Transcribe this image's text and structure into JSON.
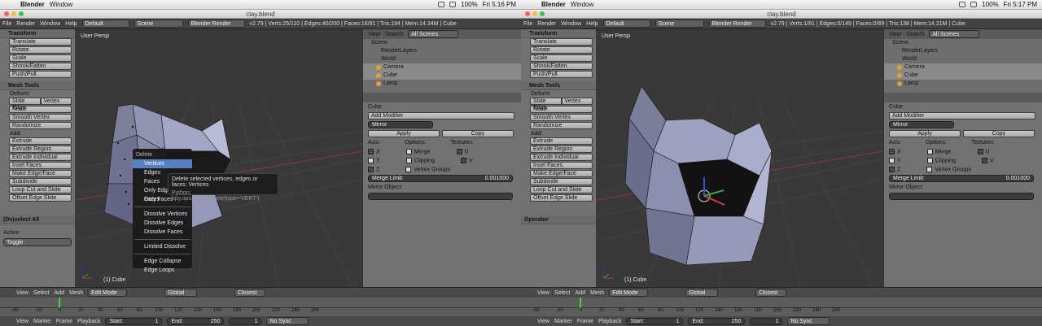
{
  "left": {
    "mac": {
      "apple": "",
      "app": "Blender",
      "menu": "Window",
      "time": "Fri 5:16 PM",
      "battery": "100%"
    },
    "title": "clay.blend",
    "info": {
      "menus": [
        "File",
        "Render",
        "Window",
        "Help"
      ],
      "layout": "Default",
      "scene": "Scene",
      "engine": "Blender Render",
      "stats": "v2.79 | Verts:25/110 | Edges:40/200 | Faces:16/91 | Tris:194 | Mem:14.34M | Cube"
    },
    "tools": {
      "transform_header": "Transform",
      "transform": [
        "Translate",
        "Rotate",
        "Scale",
        "Shrink/Fatten",
        "Push/Pull"
      ],
      "mesh_header": "Mesh Tools",
      "deform": "Deform:",
      "slide_edge": "Slide Edge",
      "vertex": "Vertex",
      "mesh": [
        "Noise",
        "Smooth Vertex",
        "Randomize"
      ],
      "add": "Add:",
      "add_items": [
        "Extrude",
        "Extrude Region",
        "Extrude Individual",
        "Inset Faces",
        "Make Edge/Face",
        "Subdivide",
        "Loop Cut and Slide",
        "Offset Edge Slide"
      ]
    },
    "op": {
      "header": "(De)select All",
      "action_label": "Action",
      "action_value": "Toggle"
    },
    "view": {
      "label": "User Persp",
      "obj": "(1) Cube"
    },
    "menu": {
      "title": "Delete",
      "items": [
        "Vertices",
        "Edges",
        "Faces",
        "Only Edges & Faces",
        "Only Faces"
      ],
      "items2": [
        "Dissolve Vertices",
        "Dissolve Edges",
        "Dissolve Faces"
      ],
      "items3": [
        "Limited Dissolve"
      ],
      "items4": [
        "Edge Collapse",
        "Edge Loops"
      ]
    },
    "tip": {
      "text": "Delete selected vertices, edges or faces: Vertices",
      "python": "Python: bpy.ops.mesh.delete(type='VERT')"
    }
  },
  "right": {
    "mac": {
      "apple": "",
      "app": "Blender",
      "menu": "Window",
      "time": "Fri 5:17 PM",
      "battery": "100%"
    },
    "title": "clay.blend",
    "info": {
      "menus": [
        "File",
        "Render",
        "Window",
        "Help"
      ],
      "layout": "Default",
      "scene": "Scene",
      "engine": "Blender Render",
      "stats": "v2.79 | Verts:1/81 | Edges:0/149 | Faces:0/69 | Tris:138 | Mem:14.21M | Cube"
    },
    "op": {
      "header": "Operator"
    },
    "view": {
      "label": "User Persp",
      "obj": "(1) Cube"
    }
  },
  "outliner": {
    "view": "View",
    "search": "Search",
    "filter": "All Scenes",
    "rows": [
      "Scene",
      "RenderLayers",
      "World",
      "Camera",
      "Cube",
      "Lamp"
    ]
  },
  "props": {
    "obj": "Cube",
    "add_modifier": "Add Modifier",
    "mod_name": "Mirror",
    "apply": "Apply",
    "copy": "Copy",
    "axis": "Axis:",
    "options": "Options:",
    "textures": "Textures:",
    "x": "X",
    "y": "Y",
    "z": "Z",
    "merge": "Merge",
    "clipping": "Clipping",
    "vgroups": "Vertex Groups",
    "u": "U",
    "v": "V",
    "merge_limit": "Merge Limit:",
    "merge_value": "0.001000",
    "mirror_obj": "Mirror Object:"
  },
  "header3d": {
    "view": "View",
    "select": "Select",
    "add": "Add",
    "mesh": "Mesh",
    "mode": "Edit Mode",
    "orient": "Global",
    "snap": "Closest"
  },
  "timeline": {
    "ticks": [
      "-40",
      "-20",
      "0",
      "20",
      "40",
      "60",
      "80",
      "100",
      "120",
      "140",
      "160",
      "180",
      "200",
      "220",
      "240",
      "260"
    ],
    "view": "View",
    "marker": "Marker",
    "frame": "Frame",
    "playback": "Playback",
    "start": "Start:",
    "start_val": "1",
    "end": "End:",
    "end_val": "250",
    "cur": "1",
    "sync": "No Sync"
  }
}
